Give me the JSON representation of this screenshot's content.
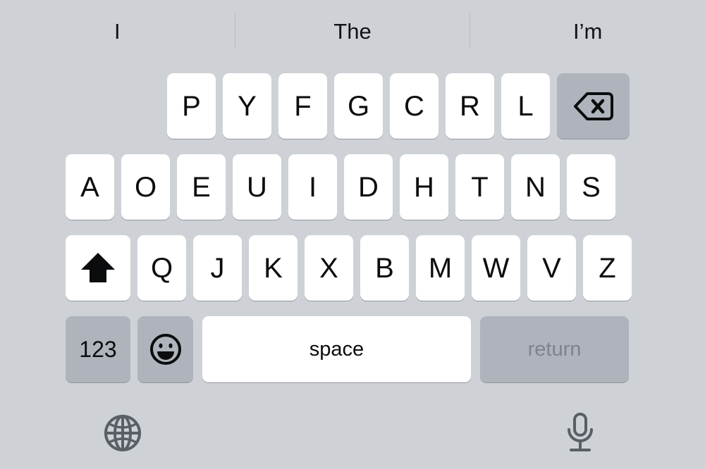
{
  "keyboard": {
    "layout_name": "Dvorak",
    "background_color": "#ced2d6",
    "key_color": "#ffffff",
    "modifier_key_color": "#afb4bc",
    "text_color": "#0b0c0d",
    "return_text_color": "#7e848c",
    "predictive": {
      "suggestions": [
        {
          "label": "I"
        },
        {
          "label": "The"
        },
        {
          "label": "I’m"
        }
      ]
    },
    "rows": {
      "row1": [
        {
          "label": "P",
          "name": "key-p"
        },
        {
          "label": "Y",
          "name": "key-y"
        },
        {
          "label": "F",
          "name": "key-f"
        },
        {
          "label": "G",
          "name": "key-g"
        },
        {
          "label": "C",
          "name": "key-c"
        },
        {
          "label": "R",
          "name": "key-r"
        },
        {
          "label": "L",
          "name": "key-l"
        }
      ],
      "row1_delete": {
        "label": "",
        "icon": "delete-backspace-icon",
        "name": "key-delete"
      },
      "row2": [
        {
          "label": "A",
          "name": "key-a"
        },
        {
          "label": "O",
          "name": "key-o"
        },
        {
          "label": "E",
          "name": "key-e"
        },
        {
          "label": "U",
          "name": "key-u"
        },
        {
          "label": "I",
          "name": "key-i"
        },
        {
          "label": "D",
          "name": "key-d"
        },
        {
          "label": "H",
          "name": "key-h"
        },
        {
          "label": "T",
          "name": "key-t"
        },
        {
          "label": "N",
          "name": "key-n"
        },
        {
          "label": "S",
          "name": "key-s"
        }
      ],
      "row3_shift": {
        "label": "",
        "icon": "shift-arrow-up-icon",
        "name": "key-shift",
        "state": "active"
      },
      "row3": [
        {
          "label": "Q",
          "name": "key-q"
        },
        {
          "label": "J",
          "name": "key-j"
        },
        {
          "label": "K",
          "name": "key-k"
        },
        {
          "label": "X",
          "name": "key-x"
        },
        {
          "label": "B",
          "name": "key-b"
        },
        {
          "label": "M",
          "name": "key-m"
        },
        {
          "label": "W",
          "name": "key-w"
        },
        {
          "label": "V",
          "name": "key-v"
        },
        {
          "label": "Z",
          "name": "key-z"
        }
      ],
      "row4": {
        "numeric": "123",
        "emoji_icon": "emoji-smiley-icon",
        "space": "space",
        "return": "return"
      }
    },
    "bottom": {
      "globe_icon": "globe-icon",
      "mic_icon": "microphone-icon",
      "icon_color": "#5a5f66"
    }
  }
}
